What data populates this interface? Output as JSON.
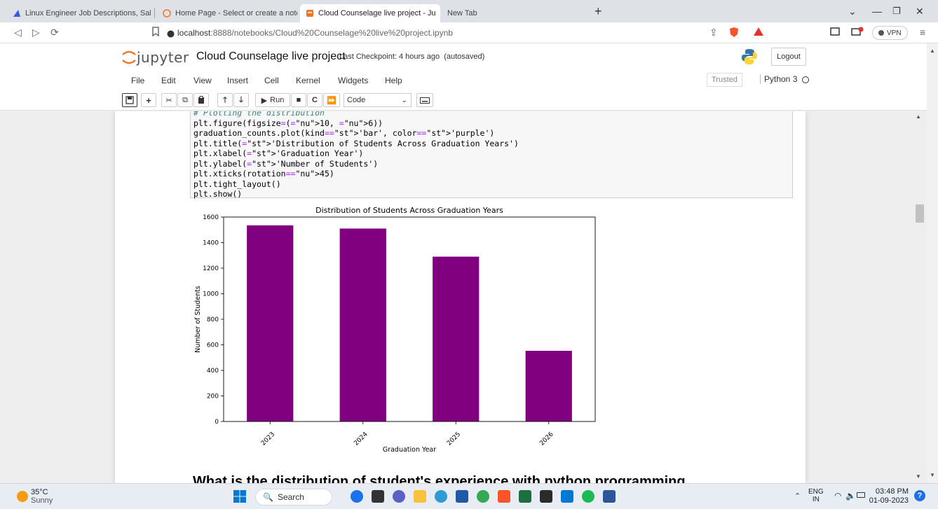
{
  "browser": {
    "tabs": [
      {
        "title": "Linux Engineer Job Descriptions, Salar",
        "active": false
      },
      {
        "title": "Home Page - Select or create a notebo",
        "active": false
      },
      {
        "title": "Cloud Counselage live project - Ju",
        "active": true
      },
      {
        "title": "New Tab",
        "active": false
      }
    ],
    "url_host": "localhost",
    "url_rest": ":8888/notebooks/Cloud%20Counselage%20live%20project.ipynb",
    "vpn_label": "VPN"
  },
  "jupyter": {
    "logo_text": "jupyter",
    "notebook_title": "Cloud Counselage live project",
    "checkpoint": "Last Checkpoint: 4 hours ago",
    "autosave": "(autosaved)",
    "logout_label": "Logout",
    "menu": [
      "File",
      "Edit",
      "View",
      "Insert",
      "Cell",
      "Kernel",
      "Widgets",
      "Help"
    ],
    "trusted_label": "Trusted",
    "kernel_name": "Python 3",
    "toolbar": {
      "run_label": "Run",
      "cell_type": "Code"
    }
  },
  "code_cell": {
    "lines": [
      "# Plotting the distribution",
      "plt.figure(figsize=(10, 6))",
      "graduation_counts.plot(kind='bar', color='purple')",
      "plt.title('Distribution of Students Across Graduation Years')",
      "plt.xlabel('Graduation Year')",
      "plt.ylabel('Number of Students')",
      "plt.xticks(rotation=45)",
      "plt.tight_layout()",
      "plt.show()"
    ]
  },
  "chart_data": {
    "type": "bar",
    "title": "Distribution of Students Across Graduation Years",
    "xlabel": "Graduation Year",
    "ylabel": "Number of Students",
    "categories": [
      "2023",
      "2024",
      "2025",
      "2026"
    ],
    "values": [
      1535,
      1510,
      1290,
      553
    ],
    "ylim": [
      0,
      1600
    ],
    "yticks": [
      0,
      200,
      400,
      600,
      800,
      1000,
      1200,
      1400,
      1600
    ],
    "color": "#800080",
    "grid": false
  },
  "markdown_heading": "What is the distribution of student's experience with python programming",
  "taskbar": {
    "weather_temp": "35°C",
    "weather_desc": "Sunny",
    "search_label": "Search",
    "lang_top": "ENG",
    "lang_bottom": "IN",
    "time": "03:48 PM",
    "date": "01-09-2023"
  }
}
